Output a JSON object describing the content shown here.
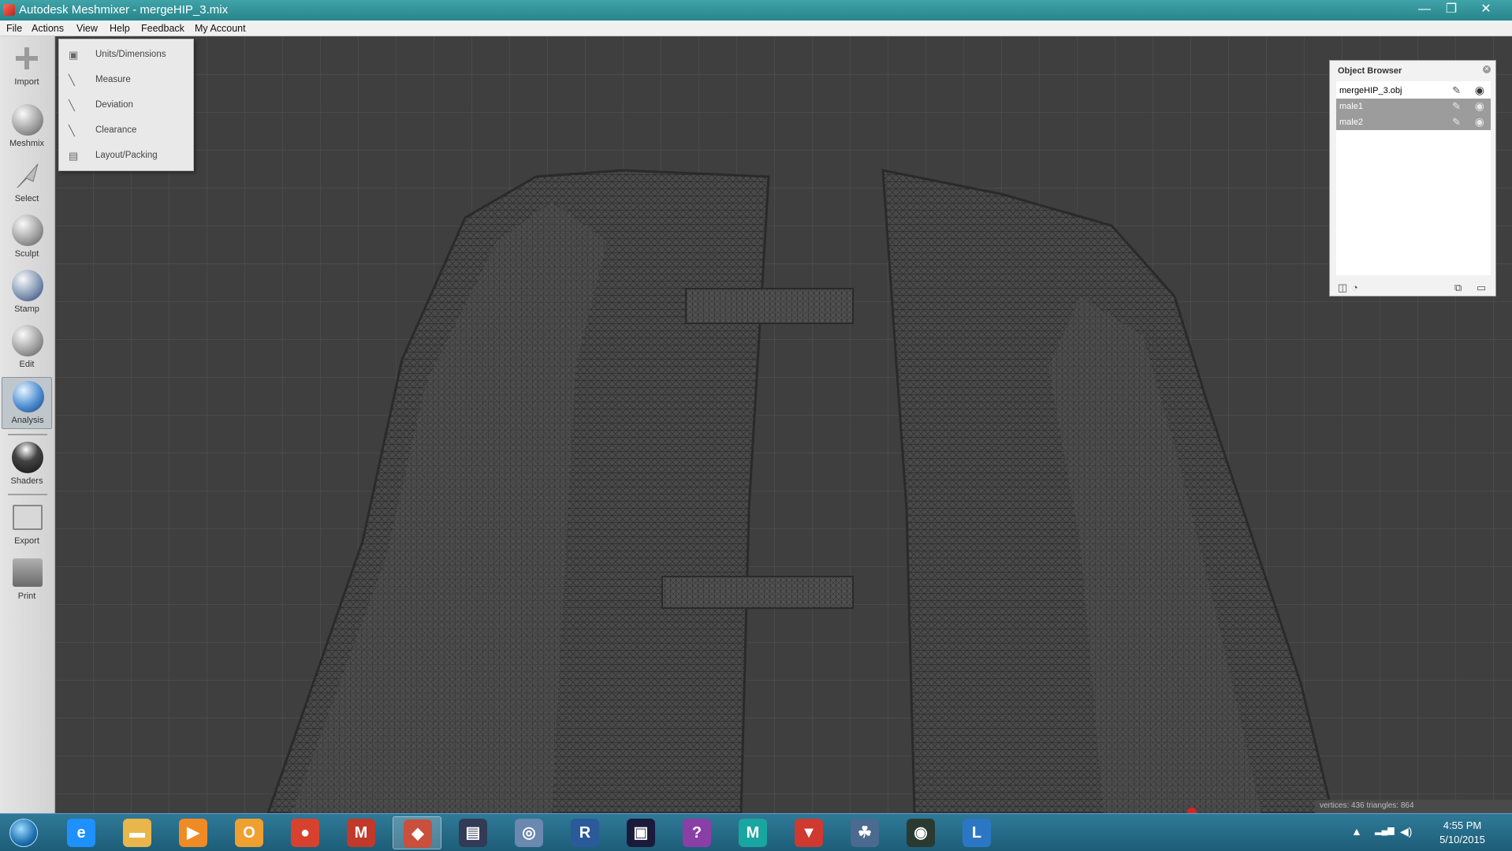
{
  "window": {
    "title": "Autodesk Meshmixer - mergeHIP_3.mix",
    "minimize": "—",
    "restore": "❐",
    "close": "✕"
  },
  "menubar": [
    "File",
    "Actions",
    "View",
    "Help",
    "Feedback",
    "My Account"
  ],
  "toolbar": [
    {
      "label": "Import",
      "icon": "plus-icon"
    },
    {
      "label": "Meshmix",
      "icon": "meshmix-icon"
    },
    {
      "label": "Select",
      "icon": "select-icon"
    },
    {
      "label": "Sculpt",
      "icon": "sculpt-icon"
    },
    {
      "label": "Stamp",
      "icon": "stamp-icon"
    },
    {
      "label": "Edit",
      "icon": "edit-icon"
    },
    {
      "label": "Analysis",
      "icon": "analysis-icon",
      "active": true
    },
    {
      "label": "Shaders",
      "icon": "shaders-icon"
    },
    {
      "label": "Export",
      "icon": "export-icon"
    },
    {
      "label": "Print",
      "icon": "print-icon"
    }
  ],
  "analysis_menu": [
    {
      "label": "Units/Dimensions",
      "icon": "units-icon"
    },
    {
      "label": "Measure",
      "icon": "measure-icon"
    },
    {
      "label": "Deviation",
      "icon": "deviation-icon"
    },
    {
      "label": "Clearance",
      "icon": "clearance-icon"
    },
    {
      "label": "Layout/Packing",
      "icon": "layout-icon"
    }
  ],
  "object_browser": {
    "title": "Object Browser",
    "objects": [
      {
        "name": "mergeHIP_3.obj",
        "selected": false
      },
      {
        "name": "male1",
        "selected": true
      },
      {
        "name": "male2",
        "selected": true
      }
    ]
  },
  "status": "vertices: 436 triangles: 864",
  "taskbar": {
    "apps": [
      {
        "name": "internet-explorer",
        "glyph": "e",
        "color": "#1e90ff"
      },
      {
        "name": "file-explorer",
        "glyph": "▬",
        "color": "#e8b64a"
      },
      {
        "name": "media-player",
        "glyph": "▶",
        "color": "#f08a24"
      },
      {
        "name": "outlook",
        "glyph": "O",
        "color": "#f0a030"
      },
      {
        "name": "chrome",
        "glyph": "●",
        "color": "#d9412f"
      },
      {
        "name": "mudbox",
        "glyph": "M",
        "color": "#c0392b"
      },
      {
        "name": "meshmixer",
        "glyph": "◆",
        "color": "#c8503c",
        "active": true
      },
      {
        "name": "terminal",
        "glyph": "▤",
        "color": "#333a55"
      },
      {
        "name": "network",
        "glyph": "◎",
        "color": "#6a88b0"
      },
      {
        "name": "revit",
        "glyph": "R",
        "color": "#2a5a99"
      },
      {
        "name": "monitor",
        "glyph": "▣",
        "color": "#1a1a3a"
      },
      {
        "name": "help",
        "glyph": "?",
        "color": "#8a3fa6"
      },
      {
        "name": "maya",
        "glyph": "M",
        "color": "#1aa6a0"
      },
      {
        "name": "app-red",
        "glyph": "▼",
        "color": "#d0392f"
      },
      {
        "name": "app-circles",
        "glyph": "☘",
        "color": "#4a6a90"
      },
      {
        "name": "camera",
        "glyph": "◉",
        "color": "#2a3a30"
      },
      {
        "name": "lync",
        "glyph": "L",
        "color": "#2c77c4"
      }
    ],
    "clock_time": "4:55 PM",
    "clock_date": "5/10/2015",
    "tray_up": "▲",
    "tray_net": "▂▄▆",
    "tray_vol": "◀)"
  }
}
